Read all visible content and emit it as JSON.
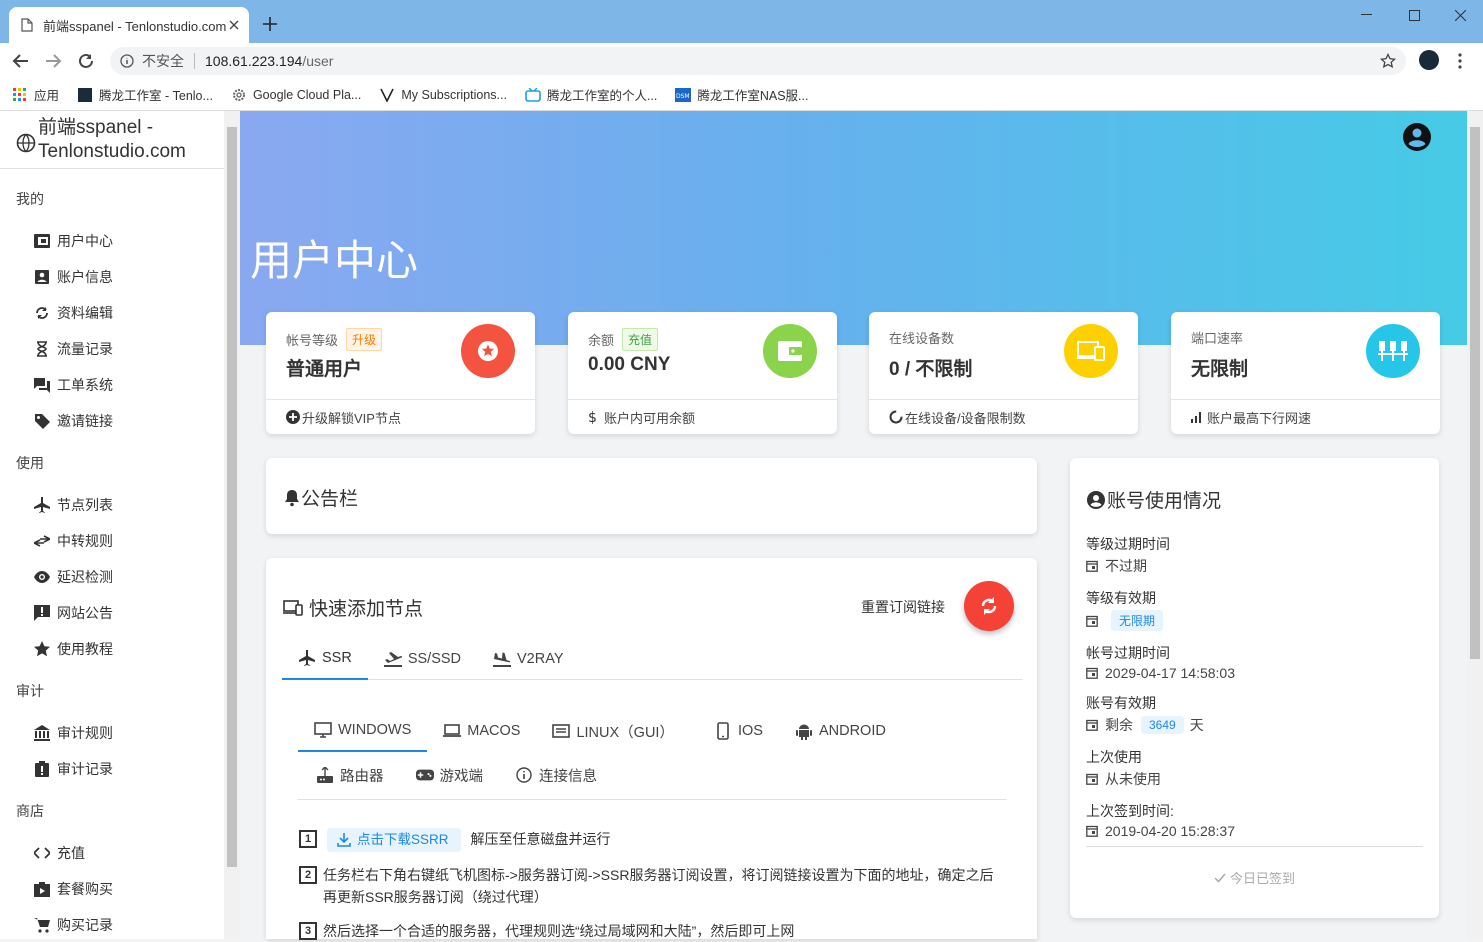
{
  "browser": {
    "tab_title": "前端sspanel - Tenlonstudio.com",
    "address_insecure": "不安全",
    "address_host": "108.61.223.194",
    "address_path": "/user",
    "bookmarks": [
      {
        "label": "应用"
      },
      {
        "label": "腾龙工作室 - Tenlo..."
      },
      {
        "label": "Google Cloud Pla..."
      },
      {
        "label": "My Subscriptions..."
      },
      {
        "label": "腾龙工作室的个人..."
      },
      {
        "label": "腾龙工作室NAS服..."
      }
    ]
  },
  "sidebar": {
    "brand": "前端sspanel - Tenlonstudio.com",
    "sections": [
      {
        "title": "我的",
        "items": [
          {
            "label": "用户中心",
            "icon": "dashboard-icon"
          },
          {
            "label": "账户信息",
            "icon": "account-box-icon"
          },
          {
            "label": "资料编辑",
            "icon": "sync-icon"
          },
          {
            "label": "流量记录",
            "icon": "hourglass-icon"
          },
          {
            "label": "工单系统",
            "icon": "forum-icon"
          },
          {
            "label": "邀请链接",
            "icon": "tag-icon"
          }
        ]
      },
      {
        "title": "使用",
        "items": [
          {
            "label": "节点列表",
            "icon": "airplane-icon"
          },
          {
            "label": "中转规则",
            "icon": "transfer-icon"
          },
          {
            "label": "延迟检测",
            "icon": "eye-icon"
          },
          {
            "label": "网站公告",
            "icon": "announcement-icon"
          },
          {
            "label": "使用教程",
            "icon": "star-icon"
          }
        ]
      },
      {
        "title": "审计",
        "items": [
          {
            "label": "审计规则",
            "icon": "bank-icon"
          },
          {
            "label": "审计记录",
            "icon": "report-icon"
          }
        ]
      },
      {
        "title": "商店",
        "items": [
          {
            "label": "充值",
            "icon": "code-icon"
          },
          {
            "label": "套餐购买",
            "icon": "shop-icon"
          },
          {
            "label": "购买记录",
            "icon": "cart-icon"
          }
        ]
      }
    ]
  },
  "hero": {
    "title": "用户中心"
  },
  "stats": [
    {
      "label": "帐号等级",
      "badge": "升级",
      "value": "普通用户",
      "footer": "升级解锁VIP节点",
      "color": "#f4533f"
    },
    {
      "label": "余额",
      "badge": "充值",
      "value": "0.00 CNY",
      "footer": "账户内可用余额",
      "color": "#8bd34a"
    },
    {
      "label": "在线设备数",
      "value": "0 / 不限制",
      "footer": "在线设备/设备限制数",
      "color": "#ffd000"
    },
    {
      "label": "端口速率",
      "value": "无限制",
      "footer": "账户最高下行网速",
      "color": "#26c6e8"
    }
  ],
  "announcement": {
    "title": "公告栏"
  },
  "quick_add": {
    "title": "快速添加节点",
    "reset_label": "重置订阅链接",
    "tabs": [
      "SSR",
      "SS/SSD",
      "V2RAY"
    ],
    "platforms": [
      "WINDOWS",
      "MACOS",
      "LINUX（GUI）",
      "IOS",
      "ANDROID"
    ],
    "platforms2": [
      "路由器",
      "游戏端",
      "连接信息"
    ],
    "download_label": "点击下载SSRR",
    "step1_text": "解压至任意磁盘并运行",
    "step2_text": "任务栏右下角右键纸飞机图标->服务器订阅->SSR服务器订阅设置，将订阅链接设置为下面的地址，确定之后再更新SSR服务器订阅（绕过代理）",
    "step3_text": "然后选择一个合适的服务器，代理规则选“绕过局域网和大陆”，然后即可上网"
  },
  "usage": {
    "title": "账号使用情况",
    "level_expire_label": "等级过期时间",
    "level_expire_value": "不过期",
    "level_valid_label": "等级有效期",
    "level_valid_value": "无限期",
    "account_expire_label": "帐号过期时间",
    "account_expire_value": "2029-04-17 14:58:03",
    "account_valid_label": "账号有效期",
    "account_valid_prefix": "剩余",
    "account_valid_days": "3649",
    "account_valid_suffix": "天",
    "last_used_label": "上次使用",
    "last_used_value": "从未使用",
    "last_checkin_label": "上次签到时间:",
    "last_checkin_value": "2019-04-20 15:28:37",
    "checked_in": "今日已签到"
  }
}
